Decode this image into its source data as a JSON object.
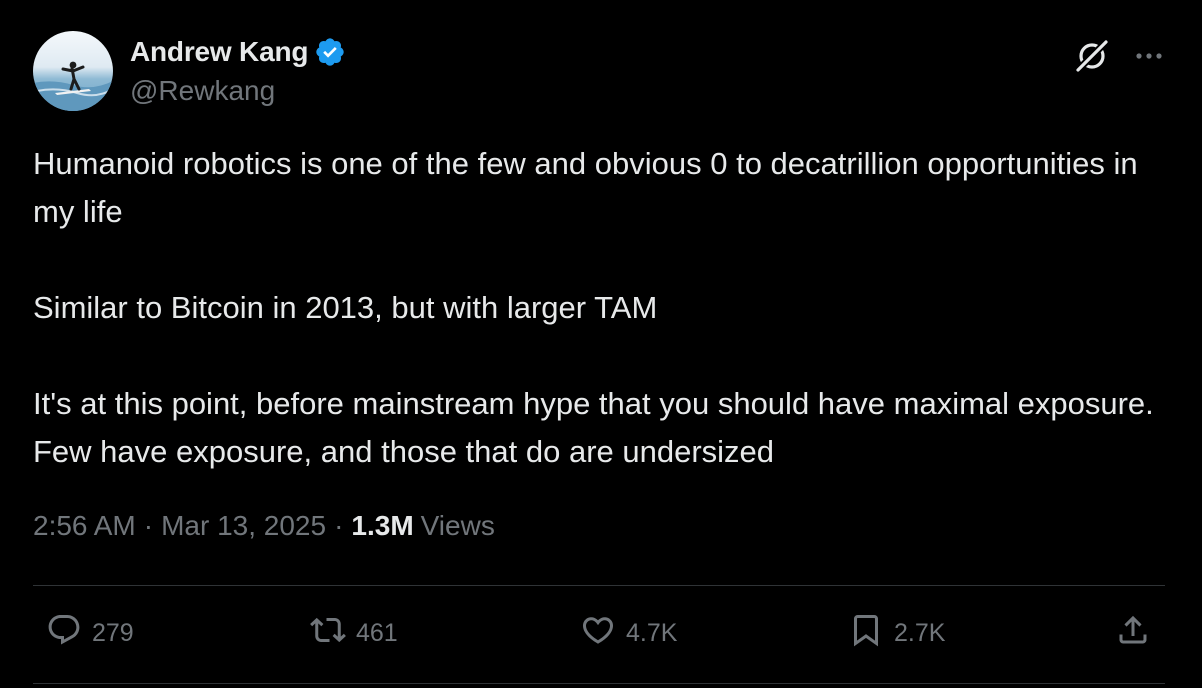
{
  "author": {
    "name": "Andrew Kang",
    "handle": "@Rewkang",
    "verified": true
  },
  "tweet": {
    "paragraphs": [
      "Humanoid robotics is one of the few and obvious 0 to decatrillion opportunities in my life",
      "Similar to Bitcoin in 2013, but with larger TAM",
      "It's at this point, before mainstream hype that you should have maximal exposure. Few have exposure, and those that do are undersized"
    ],
    "time": "2:56 AM",
    "separator": "·",
    "date": "Mar 13, 2025",
    "views_count": "1.3M",
    "views_label": "Views"
  },
  "actions": {
    "replies": "279",
    "reposts": "461",
    "likes": "4.7K",
    "bookmarks": "2.7K"
  },
  "icons": {
    "header": [
      "grok-icon",
      "more-icon"
    ],
    "actions": [
      "reply-icon",
      "repost-icon",
      "like-icon",
      "bookmark-icon",
      "share-icon"
    ]
  },
  "colors": {
    "background": "#000000",
    "text": "#e7e9ea",
    "secondary": "#71767b",
    "verified": "#1d9bf0",
    "divider": "#2f3336"
  }
}
